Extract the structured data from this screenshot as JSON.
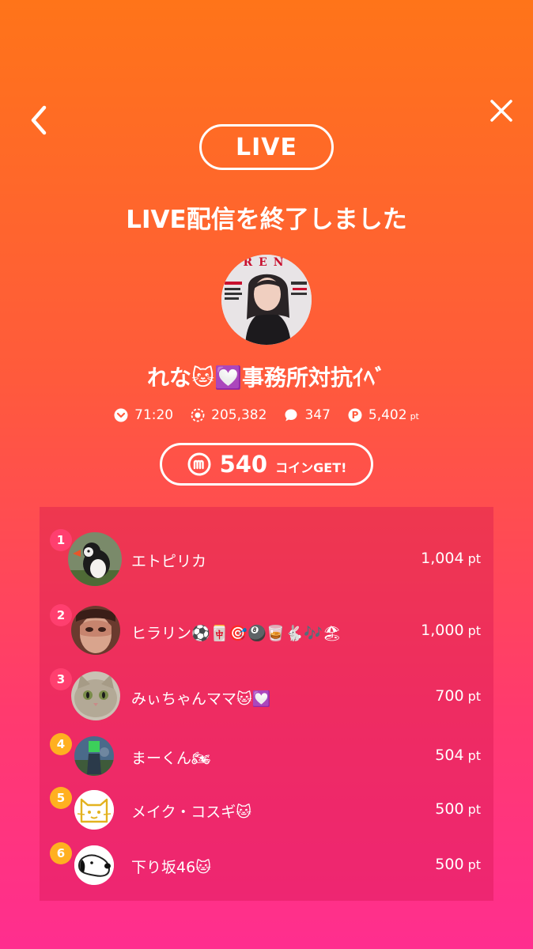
{
  "header": {
    "back_icon": "chevron-left-icon",
    "close_icon": "close-icon",
    "live_label": "LIVE",
    "end_title": "LIVE配信を終了しました"
  },
  "streamer": {
    "name": "れな🐱💟事務所対抗ｲﾍﾞ",
    "avatar_icon": "magazine-cover-avatar"
  },
  "stats": {
    "duration": "71:20",
    "viewers": "205,382",
    "comments": "347",
    "points": "5,402",
    "points_unit": "pt"
  },
  "coins": {
    "amount": "540",
    "label": "コインGET!"
  },
  "ranking": {
    "unit": "pt",
    "items": [
      {
        "rank": "1",
        "name": "エトピリカ",
        "points": "1,004",
        "badge_color": "#ff3f6f",
        "avatar_icon": "puffin-avatar"
      },
      {
        "rank": "2",
        "name": "ヒラリン⚽🀄🎯🎱🥃🐇🎶🏖",
        "points": "1,000",
        "badge_color": "#ff3f6f",
        "avatar_icon": "mask-avatar"
      },
      {
        "rank": "3",
        "name": "みぃちゃんママ🐱💟",
        "points": "700",
        "badge_color": "#ff3f6f",
        "avatar_icon": "cat-avatar"
      },
      {
        "rank": "4",
        "name": "まーくん🏍",
        "points": "504",
        "badge_color": "#ffb020",
        "avatar_icon": "photo-avatar"
      },
      {
        "rank": "5",
        "name": "メイク・コスギ🐱",
        "points": "500",
        "badge_color": "#ffb020",
        "avatar_icon": "cat-drawing-avatar"
      },
      {
        "rank": "6",
        "name": "下り坂46🐱",
        "points": "500",
        "badge_color": "#ffb020",
        "avatar_icon": "dog-drawing-avatar"
      }
    ]
  }
}
